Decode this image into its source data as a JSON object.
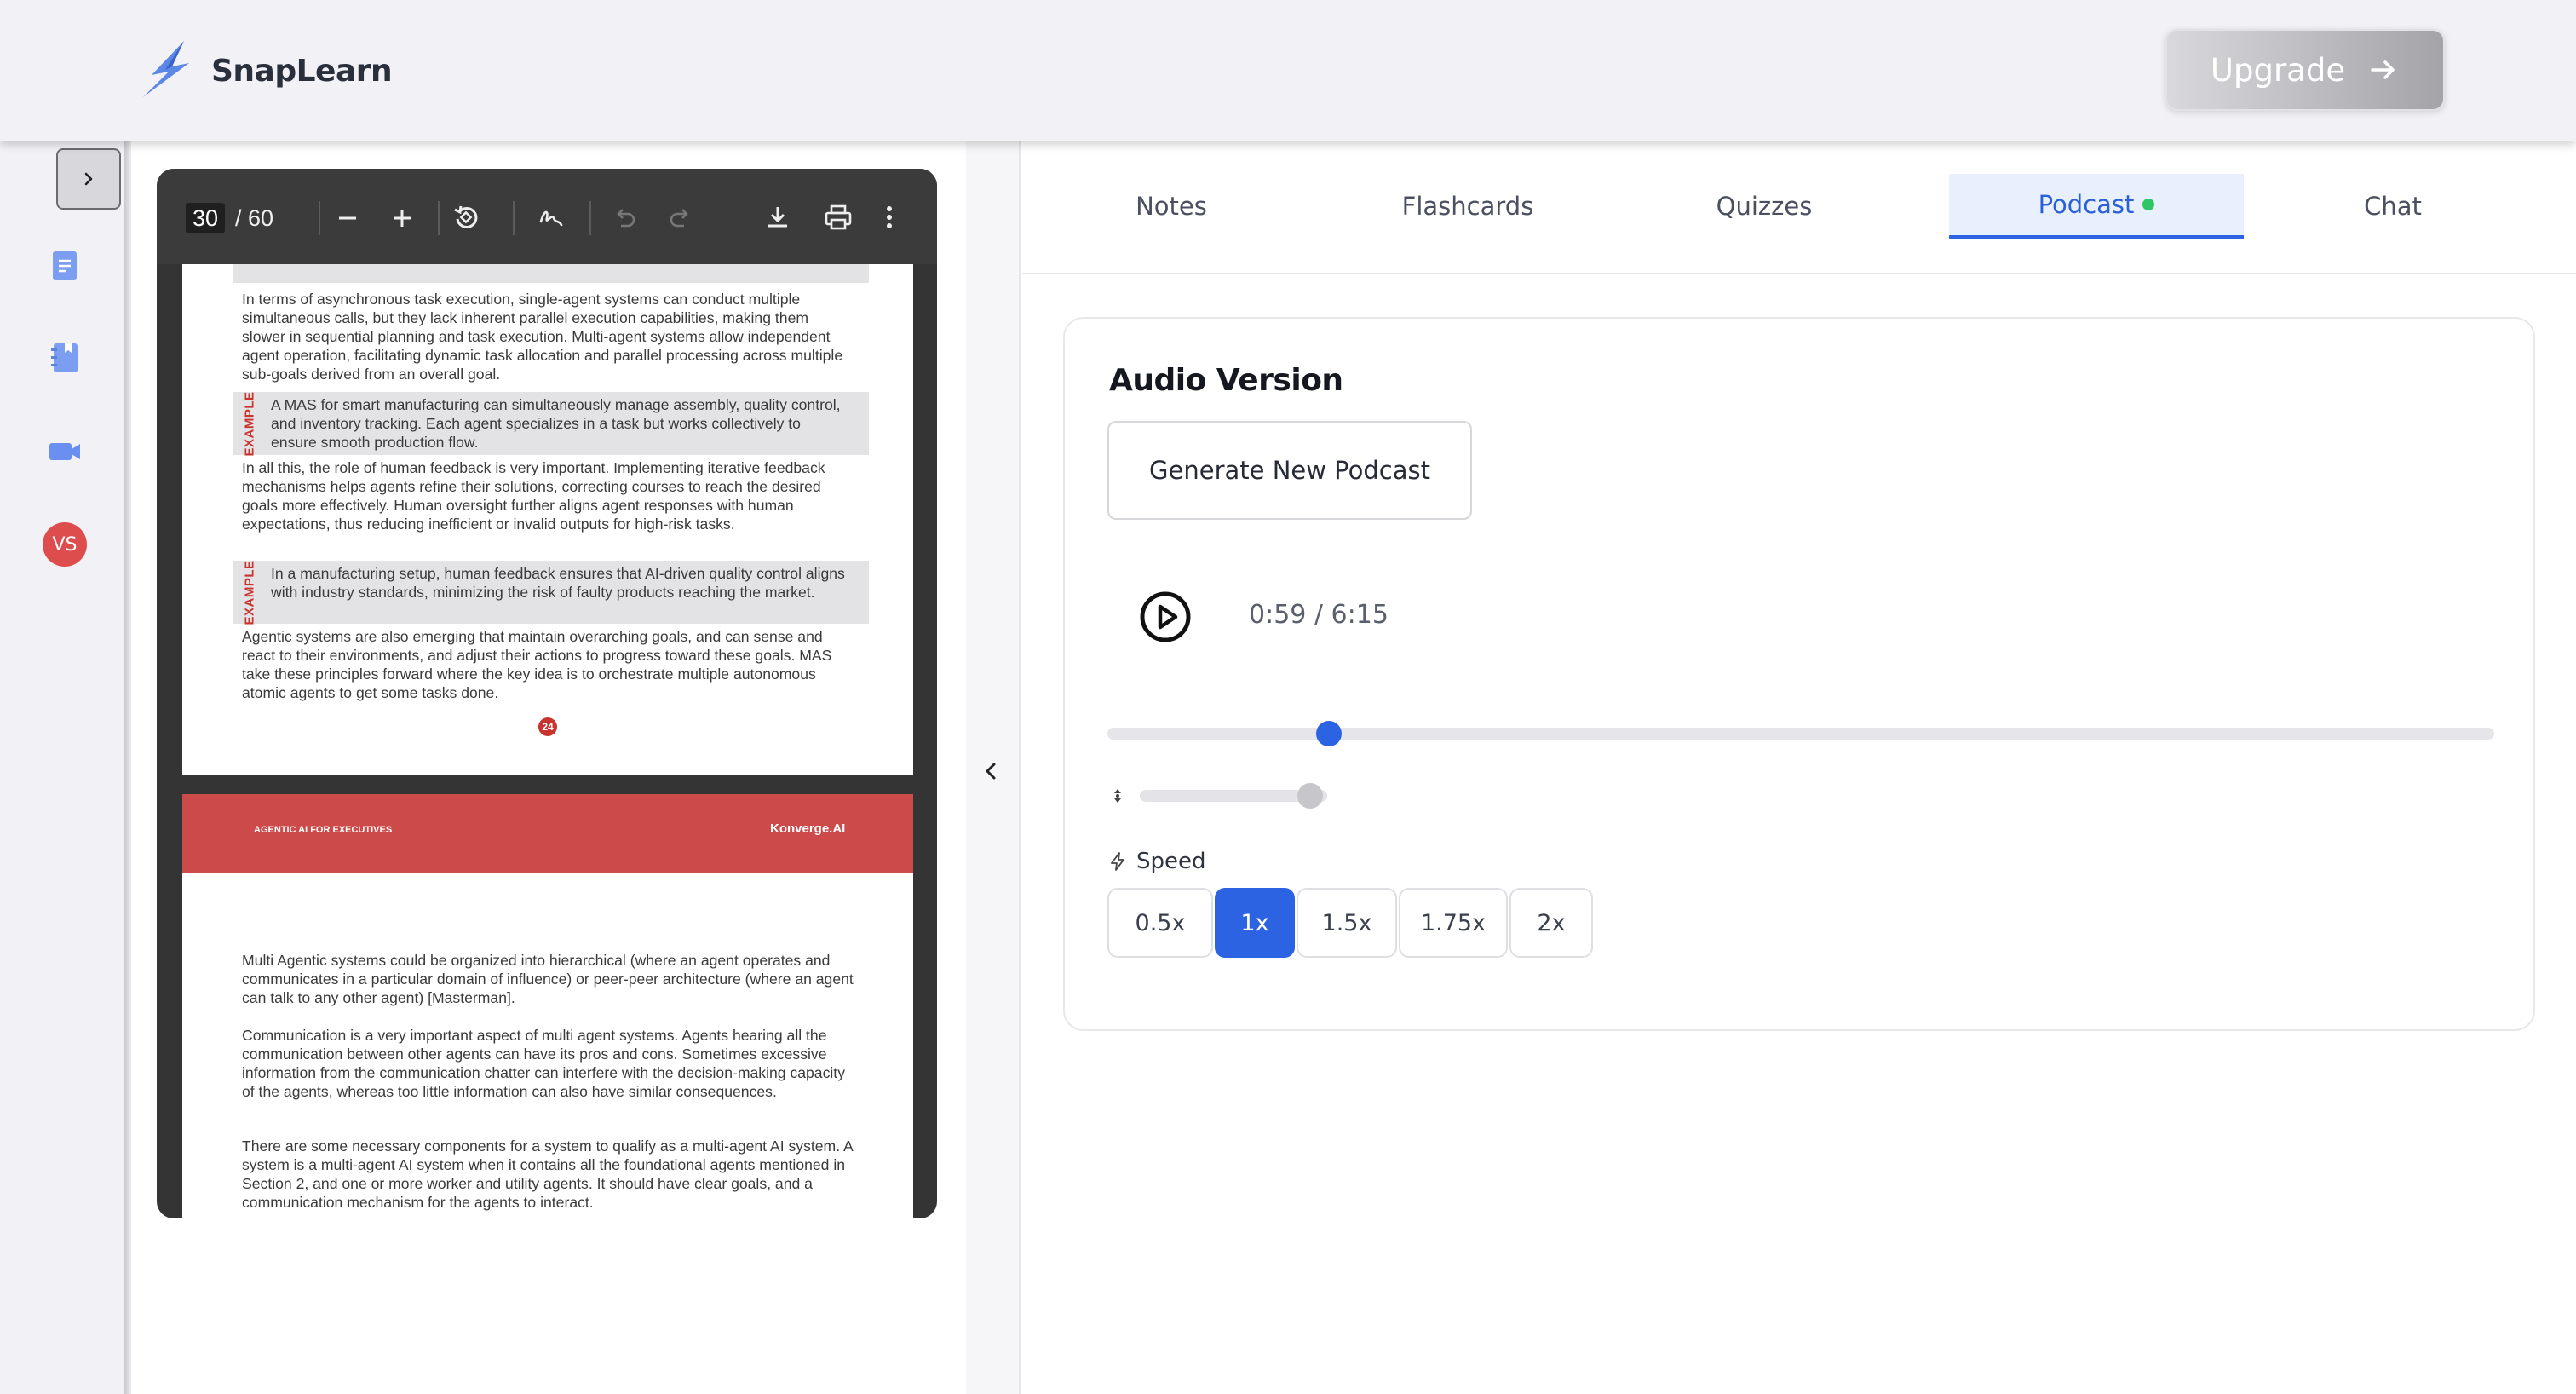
{
  "header": {
    "brand": "SnapLearn",
    "upgrade_label": "Upgrade",
    "accent_gray": "#a4a4a8"
  },
  "rail": {
    "toggle_icon": "chevron-right-icon",
    "items": [
      {
        "icon": "document-icon"
      },
      {
        "icon": "notebook-icon"
      },
      {
        "icon": "video-camera-icon"
      }
    ],
    "avatar_initials": "VS",
    "avatar_color": "#de4d4d"
  },
  "viewer": {
    "current_page": "30",
    "total_pages": "/ 60",
    "tools": [
      "zoom-out-icon",
      "zoom-in-icon",
      "rotate-icon",
      "annotate-icon",
      "undo-icon",
      "redo-icon",
      "download-icon",
      "print-icon",
      "more-vertical-icon"
    ],
    "page1": {
      "p1": "In terms of asynchronous task execution, single-agent systems can conduct multiple simultaneous calls, but they lack inherent parallel execution capabilities, making them slower in sequential planning and task execution. Multi-agent systems allow independent agent operation, facilitating dynamic task allocation and parallel processing across multiple sub-goals derived from an overall goal.",
      "ex1_label": "EXAMPLE",
      "ex1": "A MAS for smart manufacturing can simultaneously manage assembly, quality control, and inventory tracking. Each agent specializes in a task but works collectively to ensure smooth production flow.",
      "p2": "In all this, the role of human feedback is very important. Implementing iterative feedback mechanisms helps agents refine their solutions, correcting courses to reach the desired goals more effectively. Human oversight further aligns agent responses with human expectations, thus reducing inefficient or invalid outputs for high-risk tasks.",
      "ex2_label": "EXAMPLE",
      "ex2": "In a manufacturing setup, human feedback ensures that AI-driven quality control aligns with industry standards, minimizing the risk of faulty products reaching the market.",
      "p3": "Agentic systems are also emerging that maintain overarching goals, and can sense and react to their environments, and adjust their actions to progress toward these goals. MAS take these principles forward where the key idea is to orchestrate multiple autonomous atomic agents to get some tasks done.",
      "page_number": "24"
    },
    "page2": {
      "band_left": "AGENTIC AI FOR EXECUTIVES",
      "band_right": "Konverge.AI",
      "p1": "Multi Agentic systems could be organized into hierarchical (where an agent operates and communicates in a particular domain of influence) or peer-peer architecture (where an agent can talk to any other agent) [Masterman].",
      "p2": "Communication is a very important aspect of multi agent systems. Agents hearing all the communication between other agents can have its pros and cons. Sometimes excessive information from the communication chatter can interfere with the decision-making capacity of the agents, whereas too little information can also have similar consequences.",
      "p3": "There are some necessary components for a system to qualify as a multi-agent AI system. A system is a multi-agent AI system when it contains all the foundational agents mentioned in Section 2, and one or more worker and utility agents. It should have clear goals, and a communication mechanism for the agents to interact."
    }
  },
  "tabs": [
    {
      "label": "Notes"
    },
    {
      "label": "Flashcards"
    },
    {
      "label": "Quizzes"
    },
    {
      "label": "Podcast",
      "active": true,
      "status_dot_color": "#2ec768"
    },
    {
      "label": "Chat"
    }
  ],
  "podcast": {
    "title": "Audio Version",
    "generate_label": "Generate New Podcast",
    "time_display": "0:59 / 6:15",
    "progress_fraction": 0.16,
    "volume_fraction": 0.91,
    "speed_label": "Speed",
    "speeds": [
      "0.5x",
      "1x",
      "1.5x",
      "1.75x",
      "2x"
    ],
    "selected_speed": "1x",
    "accent": "#2b63e3"
  }
}
